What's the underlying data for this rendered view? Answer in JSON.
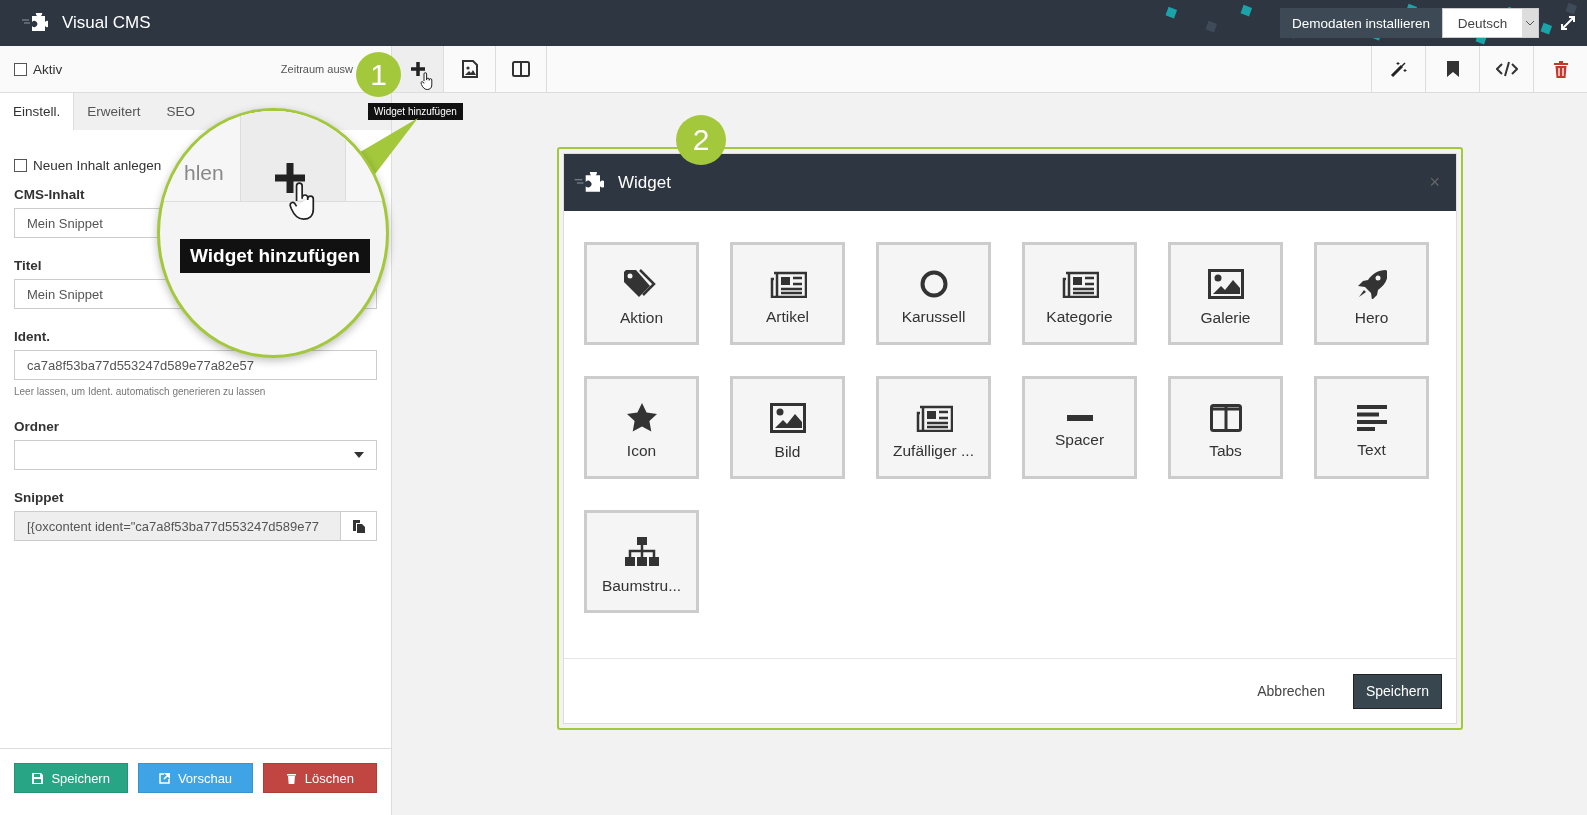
{
  "app": {
    "title": "Visual CMS",
    "demo_button": "Demodaten installieren",
    "language": "Deutsch"
  },
  "toolbar": {
    "active": {
      "label": "Aktiv",
      "checked": false
    },
    "period_label": "Zeitraum ausw",
    "tooltip": "Widget hinzufügen"
  },
  "tabs": [
    {
      "label": "Einstell.",
      "selected": true
    },
    {
      "label": "Erweitert",
      "selected": false
    },
    {
      "label": "SEO",
      "selected": false
    }
  ],
  "form": {
    "new_content": {
      "label": "Neuen Inhalt anlegen",
      "checked": false
    },
    "cms_content": {
      "label": "CMS-Inhalt",
      "value": "Mein Snippet"
    },
    "title": {
      "label": "Titel",
      "value": "Mein Snippet"
    },
    "ident": {
      "label": "Ident.",
      "value": "ca7a8f53ba77d553247d589e77a82e57",
      "hint": "Leer lassen, um Ident. automatisch generieren zu lassen"
    },
    "folder": {
      "label": "Ordner"
    },
    "snippet": {
      "label": "Snippet",
      "value": "[{oxcontent ident=\"ca7a8f53ba77d553247d589e77"
    }
  },
  "actions": [
    {
      "label": "Speichern",
      "kind": "save"
    },
    {
      "label": "Vorschau",
      "kind": "preview"
    },
    {
      "label": "Löschen",
      "kind": "delete"
    }
  ],
  "callouts": [
    "1",
    "2"
  ],
  "magnifier": {
    "partial_text": "hlen",
    "tooltip": "Widget hinzufügen"
  },
  "modal": {
    "title": "Widget",
    "close": "×",
    "widgets": [
      {
        "label": "Aktion",
        "kind": "tag"
      },
      {
        "label": "Artikel",
        "kind": "newspaper"
      },
      {
        "label": "Karussell",
        "kind": "circle"
      },
      {
        "label": "Kategorie",
        "kind": "newspaper"
      },
      {
        "label": "Galerie",
        "kind": "image"
      },
      {
        "label": "Hero",
        "kind": "rocket"
      },
      {
        "label": "Icon",
        "kind": "star"
      },
      {
        "label": "Bild",
        "kind": "image"
      },
      {
        "label": "Zufälliger ...",
        "kind": "newspaper"
      },
      {
        "label": "Spacer",
        "kind": "minus"
      },
      {
        "label": "Tabs",
        "kind": "columns"
      },
      {
        "label": "Text",
        "kind": "text"
      },
      {
        "label": "Baumstru...",
        "kind": "sitemap"
      }
    ],
    "cancel": "Abbrechen",
    "save": "Speichern"
  }
}
